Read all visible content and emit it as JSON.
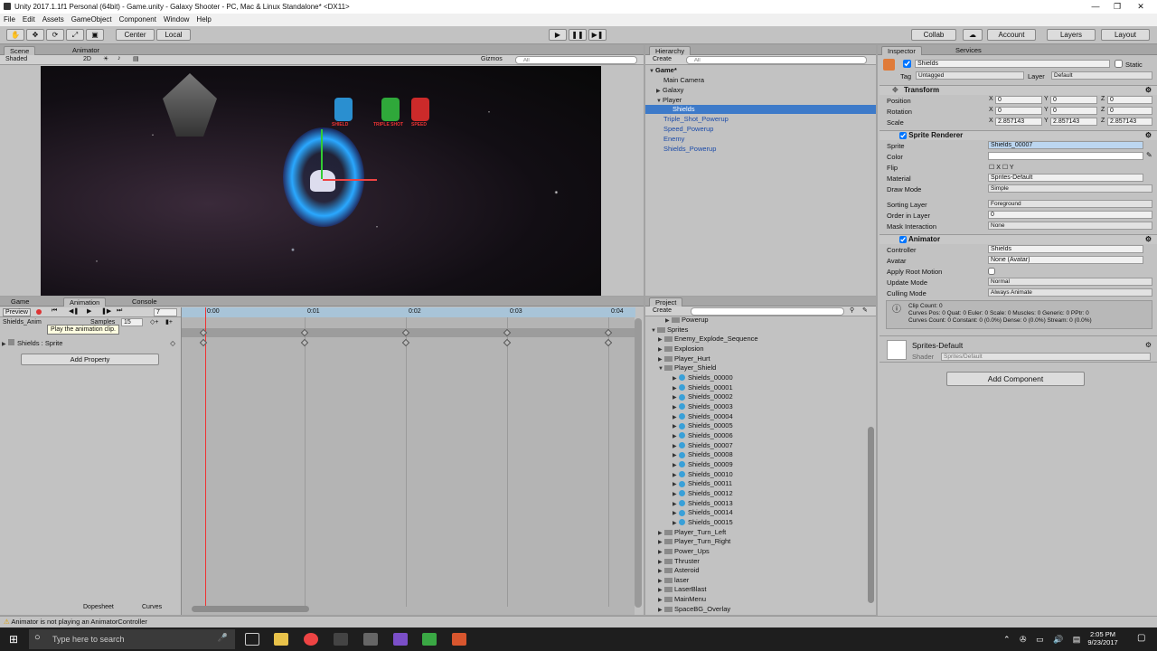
{
  "window": {
    "title": "Unity 2017.1.1f1 Personal (64bit) - Game.unity - Galaxy Shooter - PC, Mac & Linux Standalone* <DX11>",
    "watermark": "www.rrcg.cn"
  },
  "menu": [
    "File",
    "Edit",
    "Assets",
    "GameObject",
    "Component",
    "Window",
    "Help"
  ],
  "toolbar": {
    "center": "Center",
    "local": "Local",
    "collab": "Collab",
    "account": "Account",
    "layers": "Layers",
    "layout": "Layout"
  },
  "scene": {
    "tab_scene": "Scene",
    "tab_animator": "Animator",
    "shading": "Shaded",
    "mode2d": "2D",
    "gizmos": "Gizmos",
    "search_placeholder": "All",
    "powerups": [
      "SHIELD",
      "TRIPLE SHOT",
      "SPEED"
    ]
  },
  "hierarchy": {
    "tab": "Hierarchy",
    "create": "Create",
    "search_placeholder": "All",
    "scene_name": "Game*",
    "items": [
      "Main Camera",
      "Galaxy",
      "Player",
      "Shields",
      "Triple_Shot_Powerup",
      "Speed_Powerup",
      "Enemy",
      "Shields_Powerup"
    ]
  },
  "inspector": {
    "tab": "Inspector",
    "tab2": "Services",
    "object_name": "Shields",
    "static_label": "Static",
    "tag_label": "Tag",
    "tag_value": "Untagged",
    "layer_label": "Layer",
    "layer_value": "Default",
    "transform": {
      "title": "Transform",
      "position_label": "Position",
      "rotation_label": "Rotation",
      "scale_label": "Scale",
      "position": [
        "0",
        "0",
        "0"
      ],
      "rotation": [
        "0",
        "0",
        "0"
      ],
      "scale": [
        "2.857143",
        "2.857143",
        "2.857143"
      ]
    },
    "sprite_renderer": {
      "title": "Sprite Renderer",
      "sprite_label": "Sprite",
      "sprite_value": "Shields_00007",
      "color_label": "Color",
      "flip_label": "Flip",
      "material_label": "Material",
      "material_value": "Sprites-Default",
      "draw_mode_label": "Draw Mode",
      "draw_mode_value": "Simple",
      "sorting_layer_label": "Sorting Layer",
      "sorting_layer_value": "Foreground",
      "order_label": "Order in Layer",
      "order_value": "0",
      "mask_label": "Mask Interaction",
      "mask_value": "None"
    },
    "animator": {
      "title": "Animator",
      "controller_label": "Controller",
      "controller_value": "Shields",
      "avatar_label": "Avatar",
      "avatar_value": "None (Avatar)",
      "root_motion_label": "Apply Root Motion",
      "update_label": "Update Mode",
      "update_value": "Normal",
      "culling_label": "Culling Mode",
      "culling_value": "Always Animate",
      "info": [
        "Clip Count: 0",
        "Curves Pos: 0 Quat: 0 Euler: 0 Scale: 0 Muscles: 0 Generic: 0 PPtr: 0",
        "Curves Count: 0 Constant: 0 (0.0%) Dense: 0 (0.0%) Stream: 0 (0.0%)"
      ]
    },
    "material": {
      "name": "Sprites-Default",
      "shader_label": "Shader",
      "shader_value": "Sprites/Default"
    },
    "add_component": "Add Component"
  },
  "animation": {
    "tab_game": "Game",
    "tab_animation": "Animation",
    "tab_console": "Console",
    "preview": "Preview",
    "frame": "7",
    "clip": "Shields_Anim",
    "samples_label": "Samples",
    "samples_value": "15",
    "property": "Shields : Sprite",
    "add_property": "Add Property",
    "tooltip": "Play the animation clip.",
    "times": [
      "0:00",
      "0:01",
      "0:02",
      "0:03",
      "0:04"
    ],
    "dopesheet": "Dopesheet",
    "curves": "Curves"
  },
  "project": {
    "tab": "Project",
    "create": "Create",
    "items": [
      {
        "name": "Powerup",
        "type": "folder"
      },
      {
        "name": "Sprites",
        "type": "folder"
      },
      {
        "name": "Enemy_Explode_Sequence",
        "type": "folder"
      },
      {
        "name": "Explosion",
        "type": "folder"
      },
      {
        "name": "Player_Hurt",
        "type": "folder"
      },
      {
        "name": "Player_Shield",
        "type": "folder"
      },
      {
        "name": "Shields_00000",
        "type": "sprite"
      },
      {
        "name": "Shields_00001",
        "type": "sprite"
      },
      {
        "name": "Shields_00002",
        "type": "sprite"
      },
      {
        "name": "Shields_00003",
        "type": "sprite"
      },
      {
        "name": "Shields_00004",
        "type": "sprite"
      },
      {
        "name": "Shields_00005",
        "type": "sprite"
      },
      {
        "name": "Shields_00006",
        "type": "sprite"
      },
      {
        "name": "Shields_00007",
        "type": "sprite"
      },
      {
        "name": "Shields_00008",
        "type": "sprite"
      },
      {
        "name": "Shields_00009",
        "type": "sprite"
      },
      {
        "name": "Shields_00010",
        "type": "sprite"
      },
      {
        "name": "Shields_00011",
        "type": "sprite"
      },
      {
        "name": "Shields_00012",
        "type": "sprite"
      },
      {
        "name": "Shields_00013",
        "type": "sprite"
      },
      {
        "name": "Shields_00014",
        "type": "sprite"
      },
      {
        "name": "Shields_00015",
        "type": "sprite"
      },
      {
        "name": "Player_Turn_Left",
        "type": "folder"
      },
      {
        "name": "Player_Turn_Right",
        "type": "folder"
      },
      {
        "name": "Power_Ups",
        "type": "folder"
      },
      {
        "name": "Thruster",
        "type": "folder"
      },
      {
        "name": "Asteroid",
        "type": "asset"
      },
      {
        "name": "laser",
        "type": "asset"
      },
      {
        "name": "LaserBlast",
        "type": "asset"
      },
      {
        "name": "MainMenu",
        "type": "asset"
      },
      {
        "name": "SpaceBG_Overlay",
        "type": "asset"
      }
    ]
  },
  "status": {
    "text": "Animator is not playing an AnimatorController"
  },
  "taskbar": {
    "search_placeholder": "Type here to search",
    "time": "2:05 PM",
    "date": "9/23/2017"
  },
  "colors": {
    "accent": "#3d7ac9",
    "panel": "#c2c2c2",
    "shield": "#2aa8ff"
  }
}
